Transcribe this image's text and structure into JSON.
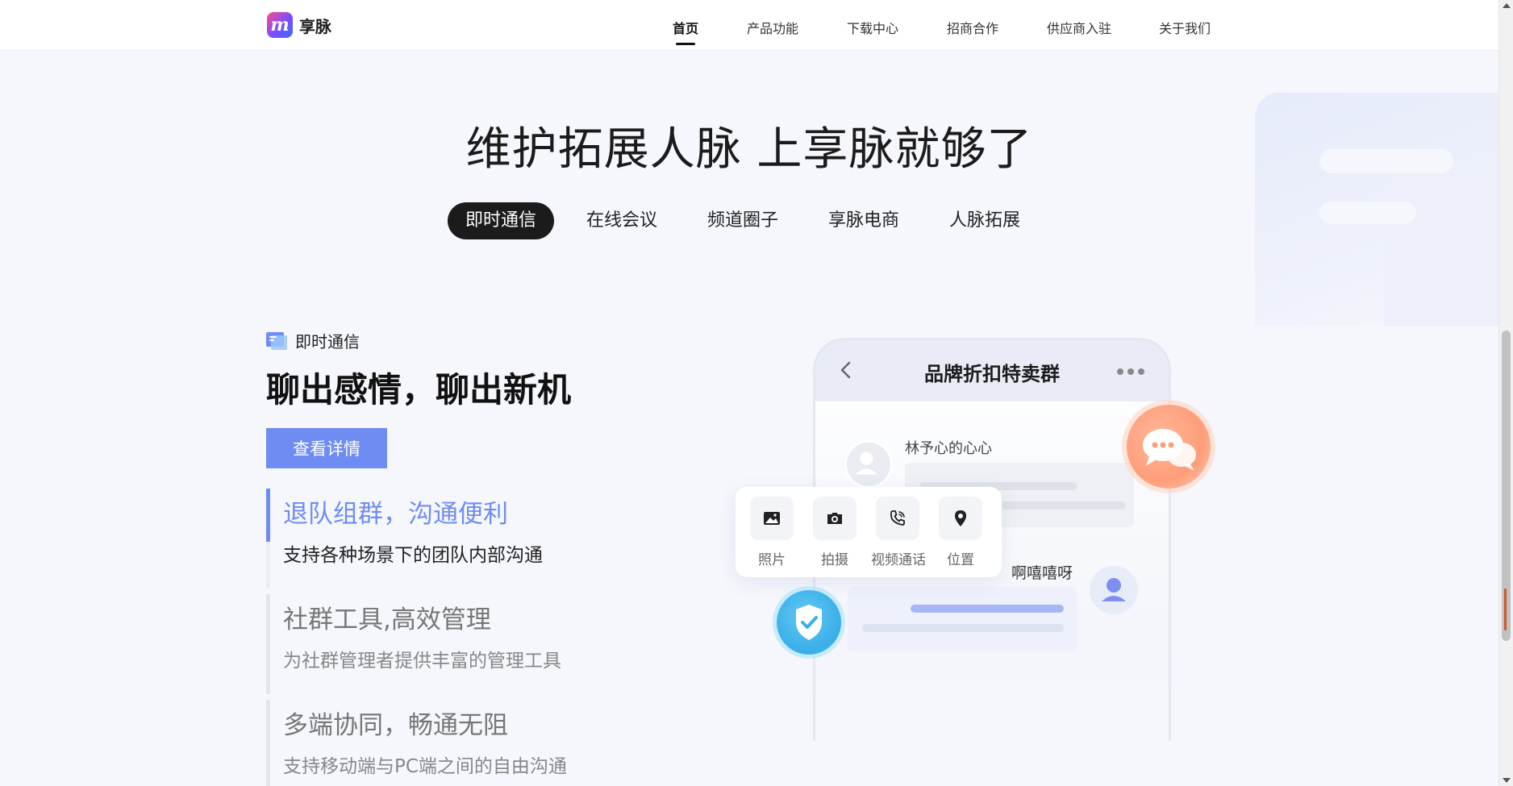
{
  "header": {
    "logo_text": "享脉",
    "logo_glyph": "m",
    "nav": [
      {
        "label": "首页",
        "active": true
      },
      {
        "label": "产品功能"
      },
      {
        "label": "下载中心"
      },
      {
        "label": "招商合作"
      },
      {
        "label": "供应商入驻"
      },
      {
        "label": "关于我们"
      }
    ]
  },
  "hero": {
    "title": "维护拓展人脉 上享脉就够了",
    "tabs": [
      {
        "label": "即时通信",
        "active": true
      },
      {
        "label": "在线会议"
      },
      {
        "label": "频道圈子"
      },
      {
        "label": "享脉电商"
      },
      {
        "label": "人脉拓展"
      }
    ]
  },
  "section": {
    "category_label": "即时通信",
    "category_icon": "chat-card-icon",
    "title": "聊出感情，聊出新机",
    "detail_button": "查看详情",
    "features": [
      {
        "title": "退队组群，沟通便利",
        "desc": "支持各种场景下的团队内部沟通",
        "active": true
      },
      {
        "title": "社群工具,高效管理",
        "desc": "为社群管理者提供丰富的管理工具"
      },
      {
        "title": "多端协同，畅通无阻",
        "desc": "支持移动端与PC端之间的自由沟通"
      }
    ]
  },
  "phone": {
    "group_title": "品牌折扣特卖群",
    "member1_name": "林予心的心心",
    "member2_name": "啊嘻嘻呀",
    "tools": [
      {
        "label": "照片",
        "icon": "image-icon"
      },
      {
        "label": "拍摄",
        "icon": "camera-icon"
      },
      {
        "label": "视频通话",
        "icon": "phone-call-icon"
      },
      {
        "label": "位置",
        "icon": "location-pin-icon"
      }
    ]
  },
  "colors": {
    "accent": "#6f8cf3",
    "dark": "#1b1b1b",
    "chat_badge": "#ff9d7a",
    "shield_badge": "#3aaee8"
  }
}
